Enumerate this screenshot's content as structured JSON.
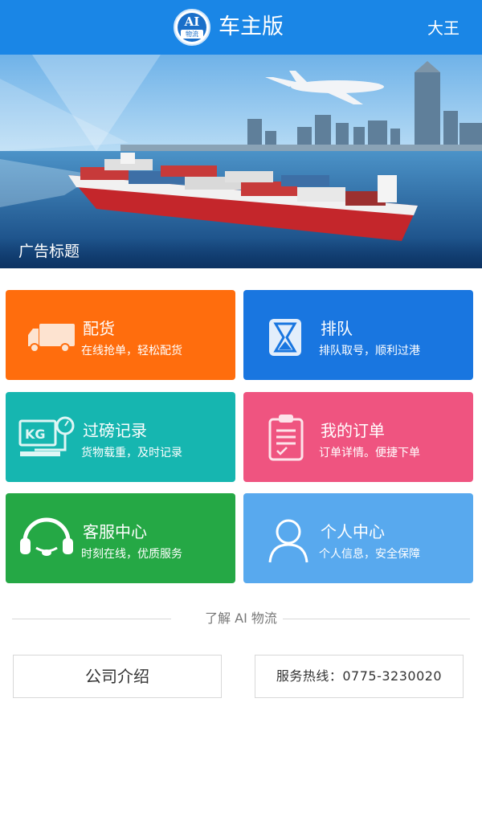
{
  "header": {
    "logo_text": "AI",
    "logo_sub": "物流",
    "title": "车主版",
    "user_name": "大王",
    "bg_color": "#1a86e6"
  },
  "banner": {
    "title": "广告标题"
  },
  "tiles": [
    {
      "title": "配货",
      "subtitle": "在线抢单，轻松配货",
      "color": "#ff6d0d",
      "icon": "truck-icon"
    },
    {
      "title": "排队",
      "subtitle": "排队取号，顺利过港",
      "color": "#1976e0",
      "icon": "hourglass-icon"
    },
    {
      "title": "过磅记录",
      "subtitle": "货物载重，及时记录",
      "color": "#16b6b0",
      "icon": "scale-icon"
    },
    {
      "title": "我的订单",
      "subtitle": "订单详情。便捷下单",
      "color": "#ef5480",
      "icon": "clipboard-icon"
    },
    {
      "title": "客服中心",
      "subtitle": "时刻在线，优质服务",
      "color": "#25a845",
      "icon": "headset-icon"
    },
    {
      "title": "个人中心",
      "subtitle": "个人信息，安全保障",
      "color": "#58a9ee",
      "icon": "user-icon"
    }
  ],
  "about": {
    "divider_label": "了解 AI 物流",
    "company_label": "公司介绍",
    "hotline_label": "服务热线：0775-3230020"
  }
}
